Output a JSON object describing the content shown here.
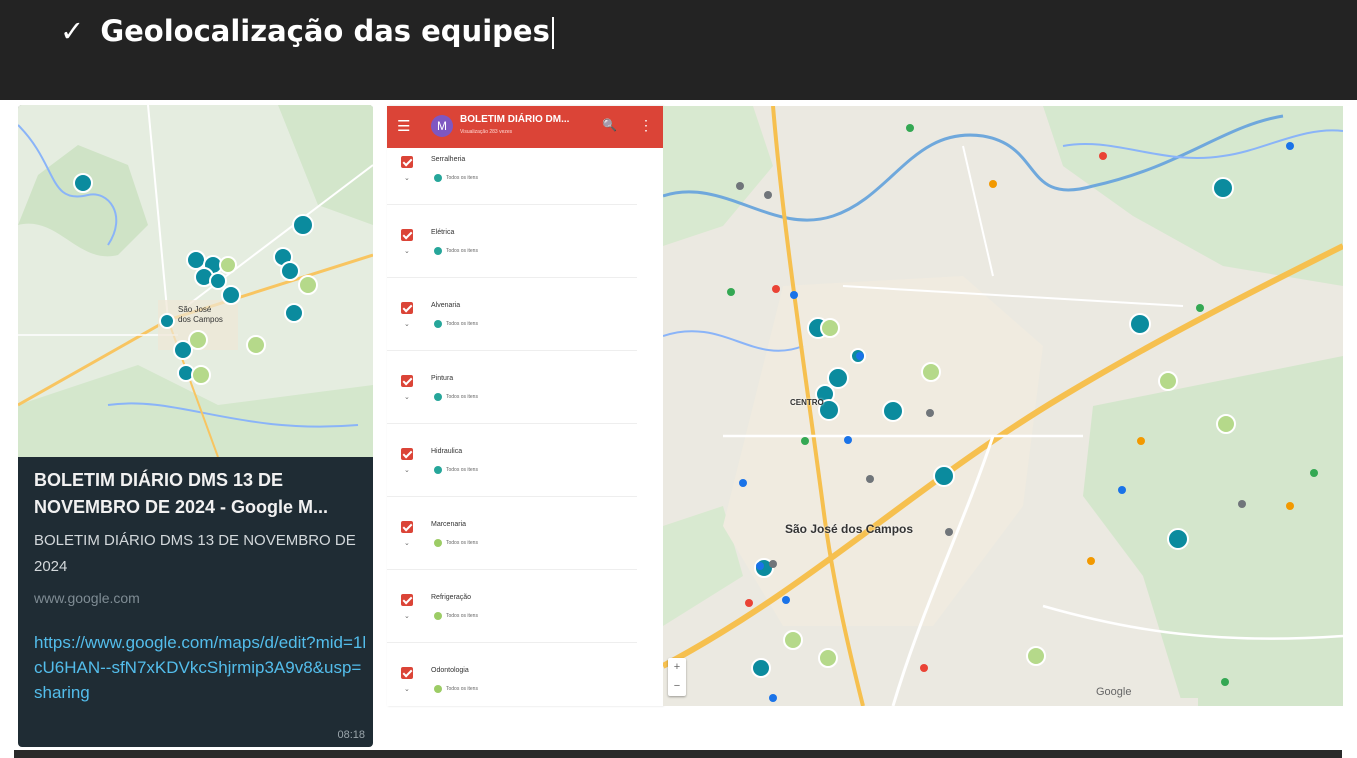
{
  "slide": {
    "check": "✓",
    "title": "Geolocalização das equipes"
  },
  "whatsapp_preview": {
    "title": "BOLETIM DIÁRIO DMS 13 DE NOVEMBRO DE 2024 - Google M...",
    "description": "BOLETIM DIÁRIO DMS 13 DE NOVEMBRO DE 2024",
    "domain": "www.google.com",
    "link": "https://www.google.com/maps/d/edit?mid=1lcU6HAN--sfN7xKDVkcShjrmip3A9v8&usp=sharing",
    "time": "08:18",
    "thumb_labels": {
      "city": "São José dos Campos"
    }
  },
  "mymaps_legend": {
    "avatar_letter": "M",
    "title": "BOLETIM DIÁRIO DM...",
    "subtitle": "Visualização 283 vezes",
    "items_text": "Todos os itens",
    "layers": [
      {
        "name": "Serralheria",
        "color": "#26a69a"
      },
      {
        "name": "Elétrica",
        "color": "#26a69a"
      },
      {
        "name": "Alvenaria",
        "color": "#26a69a"
      },
      {
        "name": "Pintura",
        "color": "#26a69a"
      },
      {
        "name": "Hidraulica",
        "color": "#26a69a"
      },
      {
        "name": "Marcenaria",
        "color": "#9ccc65"
      },
      {
        "name": "Refrigeração",
        "color": "#9ccc65"
      },
      {
        "name": "Odontologia",
        "color": "#9ccc65"
      }
    ]
  },
  "map": {
    "city_label": "São José dos Campos",
    "district_label": "CENTRO",
    "google_text": "Google",
    "zoom_in": "+",
    "zoom_out": "−"
  },
  "colors": {
    "mymaps_header": "#db4437",
    "marker_teal": "#0097a7",
    "marker_green": "#9ccc65",
    "whatsapp_bg": "#1f2c34",
    "whatsapp_link": "#53bdeb"
  }
}
